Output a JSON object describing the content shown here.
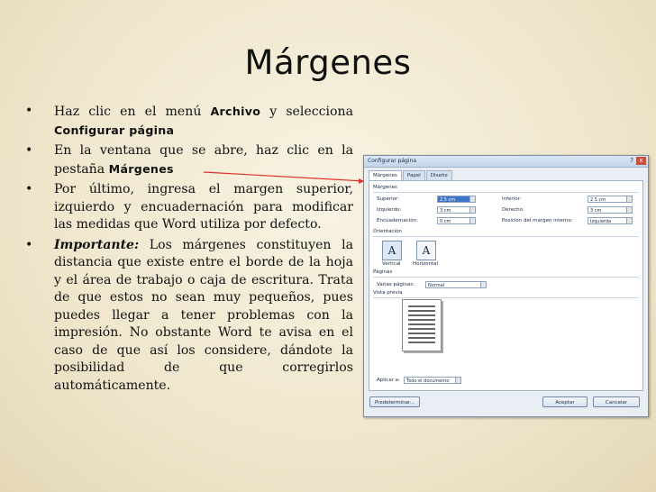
{
  "slide": {
    "title": "Márgenes",
    "bullets": [
      {
        "bullet": "•",
        "pre": "Haz clic en el menú ",
        "bold1": "Archivo",
        "mid": " y selecciona ",
        "bold2": "Configurar página"
      },
      {
        "bullet": "•",
        "pre": "En la ventana que se abre, haz clic en la pestaña ",
        "bold1": "Márgenes"
      },
      {
        "bullet": "•",
        "text": "Por último, ingresa el margen superior, izquierdo y encuadernación para modificar las medidas que Word utiliza por defecto."
      },
      {
        "bullet": "•",
        "lead": "Importante:",
        "text": " Los márgenes constituyen la distancia que existe entre el borde de la hoja y el área de trabajo o caja de escritura. Trata de que estos no sean muy pequeños, pues puedes llegar a tener problemas con la impresión. No obstante Word te avisa en el caso de que así los considere, dándote la posibilidad de que corregirlos automáticamente."
      }
    ]
  },
  "dialog": {
    "title": "Configurar página",
    "help": "?",
    "close": "x",
    "tabs": [
      "Márgenes",
      "Papel",
      "Diseño"
    ],
    "margins_section": "Márgenes",
    "fields": {
      "superior_label": "Superior:",
      "superior_value": "2.5 cm",
      "inferior_label": "Inferior:",
      "inferior_value": "2.5 cm",
      "izquierdo_label": "Izquierdo:",
      "izquierdo_value": "3 cm",
      "derecho_label": "Derecho:",
      "derecho_value": "3 cm",
      "encuadernacion_label": "Encuadernación:",
      "encuadernacion_value": "0 cm",
      "posicion_label": "Posición del margen interno:",
      "posicion_value": "Izquierda"
    },
    "orientation_section": "Orientación",
    "orientation": {
      "vertical": "Vertical",
      "horizontal": "Horizontal",
      "glyph": "A"
    },
    "pages_section": "Páginas",
    "pages": {
      "label": "Varias páginas:",
      "value": "Normal"
    },
    "preview_section": "Vista previa",
    "apply": {
      "label": "Aplicar a:",
      "value": "Todo el documento"
    },
    "buttons": {
      "default": "Predeterminar...",
      "ok": "Aceptar",
      "cancel": "Cancelar"
    }
  }
}
